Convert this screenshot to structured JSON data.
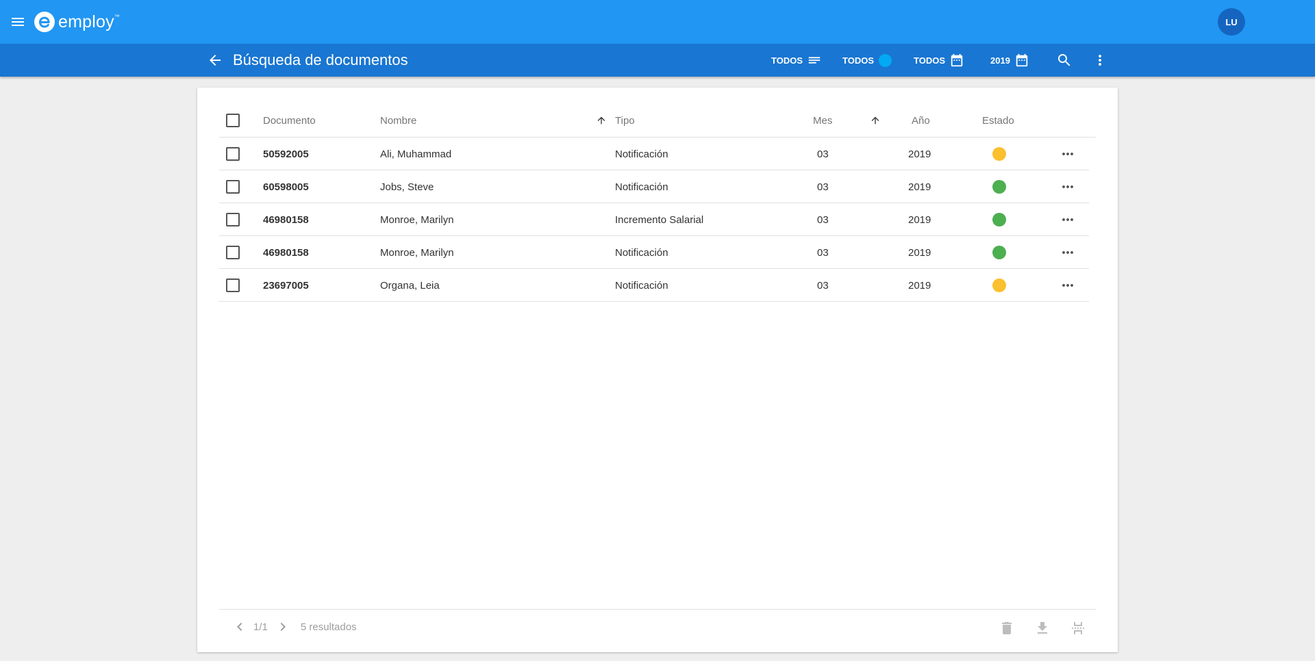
{
  "app": {
    "brand": "employ",
    "avatar_initials": "LU",
    "accent": "#2196f3",
    "toolbar_color": "#1976d2"
  },
  "toolbar": {
    "title": "Búsqueda de documentos",
    "filters": [
      {
        "label": "TODOS",
        "icon": "list-icon"
      },
      {
        "label": "TODOS",
        "icon": "status-dot-icon"
      },
      {
        "label": "TODOS",
        "icon": "calendar-icon"
      },
      {
        "label": "2019",
        "icon": "calendar-icon"
      }
    ]
  },
  "table": {
    "headers": {
      "documento": "Documento",
      "nombre": "Nombre",
      "tipo": "Tipo",
      "mes": "Mes",
      "anio": "Año",
      "estado": "Estado"
    },
    "rows": [
      {
        "documento": "50592005",
        "nombre": "Ali, Muhammad",
        "tipo": "Notificación",
        "mes": "03",
        "anio": "2019",
        "estado_color": "#fbc02d"
      },
      {
        "documento": "60598005",
        "nombre": "Jobs, Steve",
        "tipo": "Notificación",
        "mes": "03",
        "anio": "2019",
        "estado_color": "#4caf50"
      },
      {
        "documento": "46980158",
        "nombre": "Monroe, Marilyn",
        "tipo": "Incremento Salarial",
        "mes": "03",
        "anio": "2019",
        "estado_color": "#4caf50"
      },
      {
        "documento": "46980158",
        "nombre": "Monroe, Marilyn",
        "tipo": "Notificación",
        "mes": "03",
        "anio": "2019",
        "estado_color": "#4caf50"
      },
      {
        "documento": "23697005",
        "nombre": "Organa, Leia",
        "tipo": "Notificación",
        "mes": "03",
        "anio": "2019",
        "estado_color": "#fbc02d"
      }
    ]
  },
  "footer": {
    "page": "1/1",
    "results": "5 resultados"
  }
}
